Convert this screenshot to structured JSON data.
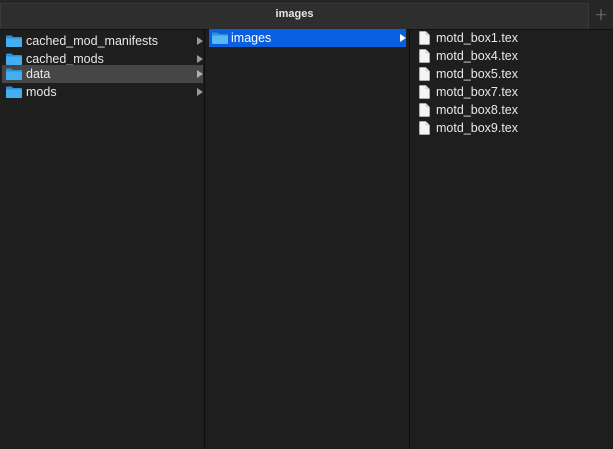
{
  "tab": {
    "title": "images",
    "add_label": "+"
  },
  "columns": {
    "col1": {
      "items": [
        {
          "label": "cached_mod_manifests",
          "icon": "folder-icon"
        },
        {
          "label": "cached_mods",
          "icon": "folder-icon"
        },
        {
          "label": "data",
          "icon": "folder-icon",
          "selected": "inactive"
        },
        {
          "label": "mods",
          "icon": "folder-icon"
        }
      ]
    },
    "col2": {
      "items": [
        {
          "label": "images",
          "icon": "folder-icon",
          "selected": "active"
        }
      ]
    },
    "col3": {
      "items": [
        {
          "label": "motd_box1.tex",
          "icon": "file-icon"
        },
        {
          "label": "motd_box4.tex",
          "icon": "file-icon"
        },
        {
          "label": "motd_box5.tex",
          "icon": "file-icon"
        },
        {
          "label": "motd_box7.tex",
          "icon": "file-icon"
        },
        {
          "label": "motd_box8.tex",
          "icon": "file-icon"
        },
        {
          "label": "motd_box9.tex",
          "icon": "file-icon"
        }
      ]
    }
  },
  "colors": {
    "background": "#1e1e1e",
    "selection_active": "#0a5ee0",
    "selection_inactive": "#464646",
    "folder": "#3fa6e6"
  }
}
